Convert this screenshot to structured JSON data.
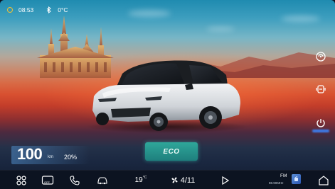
{
  "status": {
    "time": "08:53",
    "outside_temp": "0°C"
  },
  "vehicle": {
    "range_value": "100",
    "range_unit": "km",
    "battery_percent": "20%",
    "drive_mode": "ECO"
  },
  "dock": {
    "cabin_temp": "19",
    "cabin_temp_unit": "°C",
    "fan_level": "4/11",
    "media_off_label": "OFF",
    "radio_band": "FM",
    "radio_frequency": "88.90MHz"
  },
  "colors": {
    "accent_blue": "#3c7ff0",
    "eco_teal": "#2fa79a",
    "status_dot": "#f1c232"
  },
  "icons": {
    "status": [
      "status-dot-icon",
      "bluetooth-icon"
    ],
    "side": [
      "sound-settings-icon",
      "seat-icon",
      "power-icon"
    ],
    "dock": [
      "apps-grid-icon",
      "media-icon",
      "phone-icon",
      "car-icon",
      "fan-icon",
      "play-icon",
      "radio-art-icon",
      "home-icon"
    ]
  }
}
